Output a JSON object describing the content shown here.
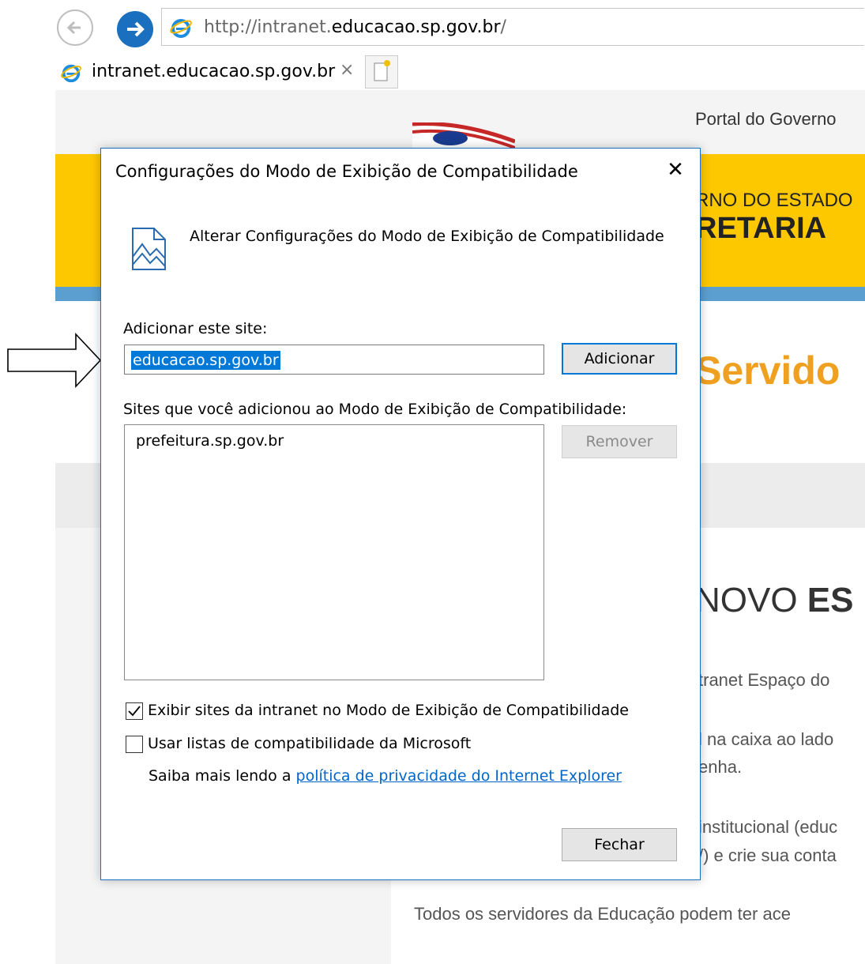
{
  "browser": {
    "address_prefix": "http://intranet.",
    "address_domain": "educacao.sp.gov.br",
    "address_suffix": "/",
    "tab_title": "intranet.educacao.sp.gov.br",
    "tab_close": "×"
  },
  "page": {
    "portal_link": "Portal do Governo",
    "gov_line": "RNO DO ESTADO",
    "sec_line": "RETARIA",
    "servid": "Servido",
    "novo_prefix": "NOVO ",
    "novo_bold": "ES",
    "p1": "tranet Espaço do",
    "p2a": "l na caixa ao lado",
    "p2b": "enha.",
    "p3a": "institucional (educ",
    "p3b": "/) e crie sua conta",
    "p4": "Todos os servidores da Educação podem ter ace"
  },
  "dialog": {
    "title": "Configurações do Modo de Exibição de Compatibilidade",
    "close_glyph": "✕",
    "heading": "Alterar Configurações do Modo de Exibição de Compatibilidade",
    "add_label": "Adicionar este site:",
    "site_value": "educacao.sp.gov.br",
    "add_button": "Adicionar",
    "list_label": "Sites que você adicionou ao Modo de Exibição de Compatibilidade:",
    "list_items": [
      "prefeitura.sp.gov.br"
    ],
    "remove_button": "Remover",
    "intranet_checkbox_label": "Exibir sites da intranet no Modo de Exibição de Compatibilidade",
    "intranet_checked": true,
    "ms_lists_checkbox_label": "Usar listas de compatibilidade da Microsoft",
    "ms_lists_checked": false,
    "privacy_prefix": "Saiba mais lendo a ",
    "privacy_link": "política de privacidade do Internet Explorer",
    "close_button": "Fechar"
  },
  "colors": {
    "accent": "#0078d7",
    "yellow_banner": "#fdc800",
    "link": "#0066cc"
  }
}
